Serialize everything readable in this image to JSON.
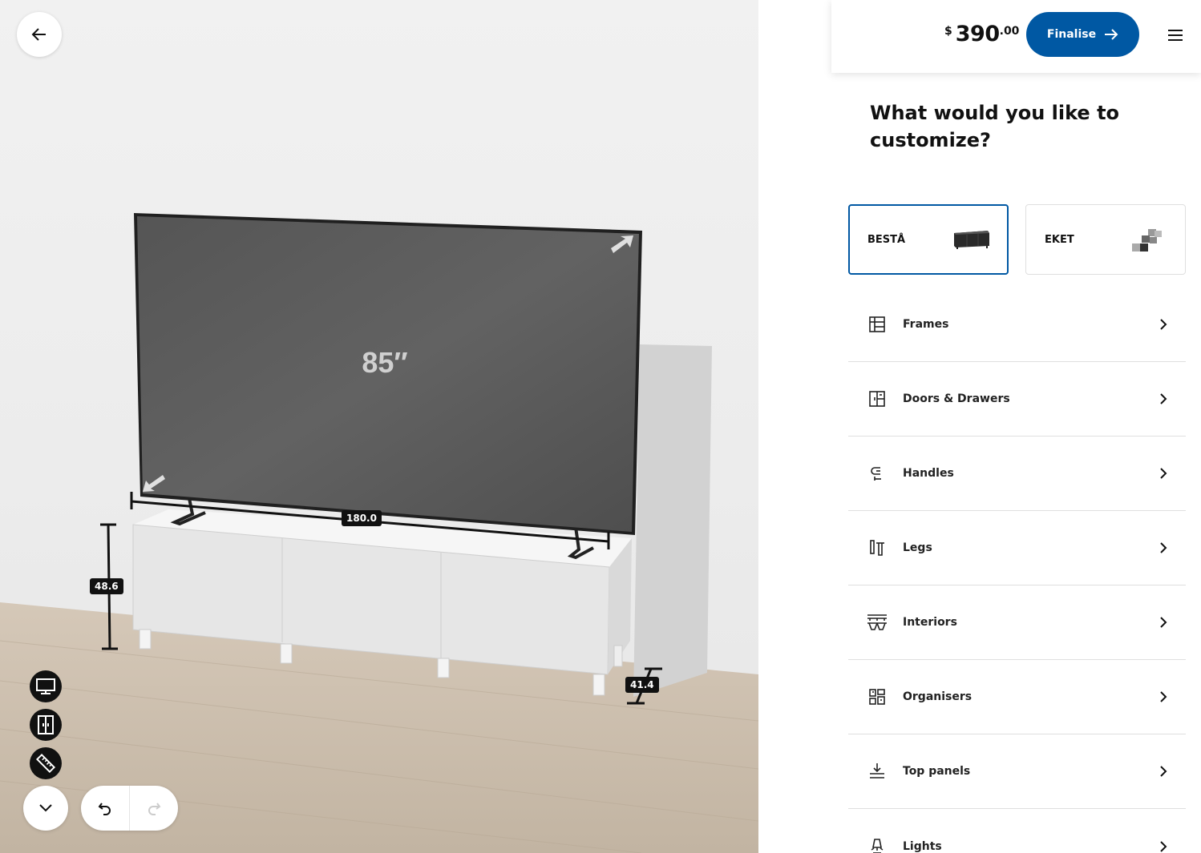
{
  "scene": {
    "tv_size": "85″",
    "dimensions": {
      "width": "180.0",
      "height": "48.6",
      "depth": "41.4"
    },
    "toolbar": {
      "items": [
        "tv-icon",
        "door-icon",
        "ruler-icon"
      ]
    }
  },
  "header": {
    "price_currency": "$",
    "price_main": "390",
    "price_cents": ".00",
    "finalise_label": "Finalise"
  },
  "panel": {
    "title": "What would you like to customize?",
    "series": [
      {
        "label": "BESTÅ",
        "selected": true
      },
      {
        "label": "EKET",
        "selected": false
      }
    ],
    "menu": [
      {
        "label": "Frames",
        "icon": "frames-icon"
      },
      {
        "label": "Doors & Drawers",
        "icon": "doors-icon"
      },
      {
        "label": "Handles",
        "icon": "handles-icon"
      },
      {
        "label": "Legs",
        "icon": "legs-icon"
      },
      {
        "label": "Interiors",
        "icon": "interiors-icon"
      },
      {
        "label": "Organisers",
        "icon": "organisers-icon"
      },
      {
        "label": "Top panels",
        "icon": "top-panels-icon"
      },
      {
        "label": "Lights",
        "icon": "lights-icon"
      }
    ]
  },
  "colors": {
    "accent": "#0058a3",
    "tv_screen": "#5a5a5a",
    "cabinet": "#e9e9e9",
    "floor": "#c9bba9"
  }
}
